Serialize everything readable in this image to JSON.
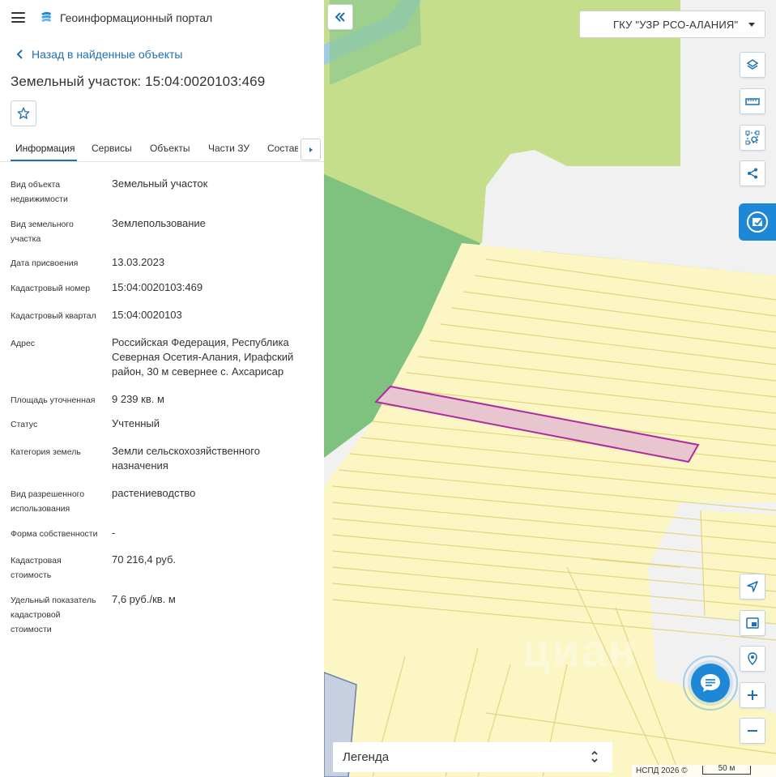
{
  "header": {
    "title": "Геоинформационный портал"
  },
  "nav": {
    "back_label": "Назад в найденные объекты"
  },
  "object": {
    "title": "Земельный участок: 15:04:0020103:469"
  },
  "tabs": [
    {
      "label": "Информация",
      "active": true
    },
    {
      "label": "Сервисы"
    },
    {
      "label": "Объекты"
    },
    {
      "label": "Части ЗУ"
    },
    {
      "label": "Состав"
    }
  ],
  "properties": [
    {
      "label": "Вид объекта недвижимости",
      "value": "Земельный участок"
    },
    {
      "label": "Вид земельного участка",
      "value": "Землепользование"
    },
    {
      "label": "Дата присвоения",
      "value": "13.03.2023"
    },
    {
      "label": "Кадастровый номер",
      "value": "15:04:0020103:469"
    },
    {
      "label": "Кадастровый квартал",
      "value": "15:04:0020103"
    },
    {
      "label": "Адрес",
      "value": "Российская Федерация, Республика Северная Осетия-Алания, Ирафский район, 30 м севернее с. Ахсарисар"
    },
    {
      "label": "Площадь уточненная",
      "value": "9 239 кв. м"
    },
    {
      "label": "Статус",
      "value": "Учтенный"
    },
    {
      "label": "Категория земель",
      "value": "Земли сельскохозяйственного назначения"
    },
    {
      "label": "Вид разрешенного использования",
      "value": "растениеводство"
    },
    {
      "label": "Форма собственности",
      "value": "-"
    },
    {
      "label": "Кадастровая стоимость",
      "value": "70 216,4 руб."
    },
    {
      "label": "Удельный показатель кадастровой стоимости",
      "value": "7,6 руб./кв. м"
    }
  ],
  "map": {
    "organization": "ГКУ \"УЗР РСО-АЛАНИЯ\"",
    "legend_label": "Легенда",
    "copyright": "НСПД 2026 ©",
    "scale_label": "50 м",
    "watermark": "циан",
    "colors": {
      "forest": "#7fc17f",
      "meadow": "#c5de8c",
      "parcel": "#fbf6c4",
      "parcel_border": "#e3d580",
      "selected_fill": "#e8c6d0",
      "selected_border": "#b02aa0",
      "water": "#9ecbe0",
      "accent": "#1e88d6"
    }
  }
}
